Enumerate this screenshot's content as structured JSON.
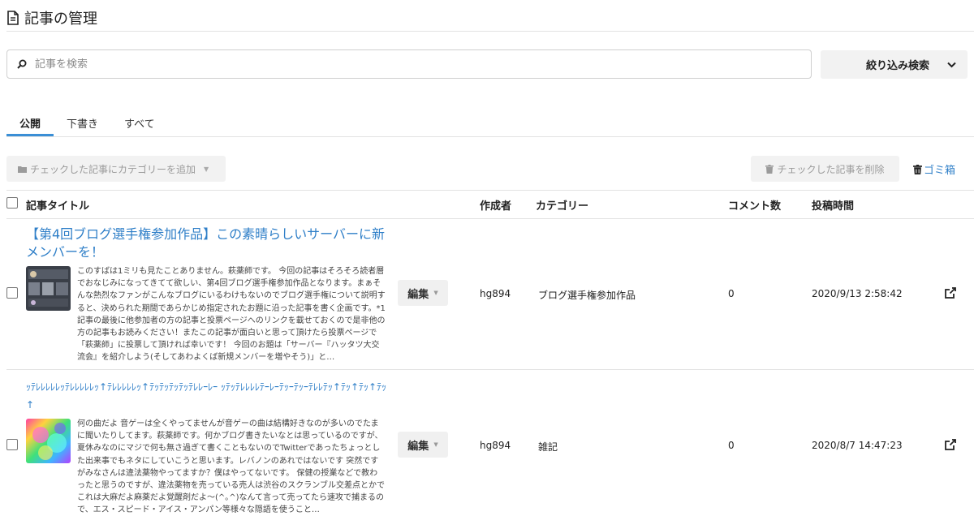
{
  "header": {
    "title": "記事の管理"
  },
  "search": {
    "placeholder": "記事を検索",
    "value": ""
  },
  "filter": {
    "label": "絞り込み検索"
  },
  "tabs": [
    {
      "label": "公開",
      "active": true
    },
    {
      "label": "下書き",
      "active": false
    },
    {
      "label": "すべて",
      "active": false
    }
  ],
  "bulk": {
    "add_category_label": "チェックした記事にカテゴリーを追加",
    "delete_label": "チェックした記事を削除",
    "trash_label": "ゴミ箱"
  },
  "table": {
    "columns": {
      "title": "記事タイトル",
      "author": "作成者",
      "category": "カテゴリー",
      "comments": "コメント数",
      "posted": "投稿時間"
    },
    "rows": [
      {
        "title": "【第4回ブログ選手権参加作品】この素晴らしいサーバーに新メンバーを！",
        "excerpt": "このすばは1ミリも見たことありません。萩薬師です。 今回の記事はそろそろ読者層でおなじみになってきてて欲しい、第4回ブログ選手権参加作品となります。まぁそんな熱烈なファンがこんなブログにいるわけもないのでブログ選手権について説明すると、決められた期間であらかじめ指定されたお題に沿った記事を書く企画です。*1 記事の最後に他参加者の方の記事と投票ページへのリンクを載せておくので是非他の方の記事もお読みください！またこの記事が面白いと思って頂けたら投票ページで「萩薬師」に投票して頂ければ幸いです！ 今回のお題は「サーバー『ハッタツ大交流会』を紹介しよう(そしてあわよくば新規メンバーを増やそう)」と…",
        "edit_label": "編集",
        "author": "hg894",
        "category": "ブログ選手権参加作品",
        "comments": "0",
        "posted": "2020/9/13 2:58:42"
      },
      {
        "title": "ｯﾃﾚﾚﾚﾚﾚｯﾃﾚﾚﾚﾚﾚｯ↑ﾃﾚﾚﾚﾚﾚｯ↑ﾃｯﾃｯﾃｯﾃｯﾃﾚﾚｰﾚｰ ｯﾃｯﾃﾚﾚﾚﾚﾃｰﾚｰﾃｯｰﾃｯｰﾃﾚﾚﾃｯ↑ﾃｯ↑ﾃｯ↑ﾃｯ↑",
        "excerpt": "何の曲だよ 音ゲーは全くやってませんが音ゲーの曲は結構好きなのが多いのでたまに聞いたりしてます。萩薬師です。何かブログ書きたいなとは思っているのですが、夏休みなのにマジで何も無さ過ぎて書くこともないのでTwitterであったちょっとした出来事でもネタにしていこうと思います。レバノンのあれではないです 突然ですがみなさんは違法薬物やってますか？僕はやってないです。 保健の授業などで教わったと思うのですが、違法薬物を売っている売人は渋谷のスクランブル交差点とかでこれは大麻だよ麻薬だよ覚醒剤だよ～(^｡^)なんて言って売ってたら速攻で捕まるので、エス・スピード・アイス・アンパン等様々な隠語を使うこと…",
        "edit_label": "編集",
        "author": "hg894",
        "category": "雑記",
        "comments": "0",
        "posted": "2020/8/7 14:47:23"
      }
    ]
  },
  "icons": {
    "header": "document-icon",
    "search": "search-icon",
    "filter": "chevron-down-icon",
    "add_category": "folder-icon",
    "delete": "trash-icon",
    "open": "external-link-icon"
  },
  "colors": {
    "accent": "#2f7fc8",
    "tab_underline": "#3b8fd6",
    "button_bg": "#f2f2f2"
  }
}
